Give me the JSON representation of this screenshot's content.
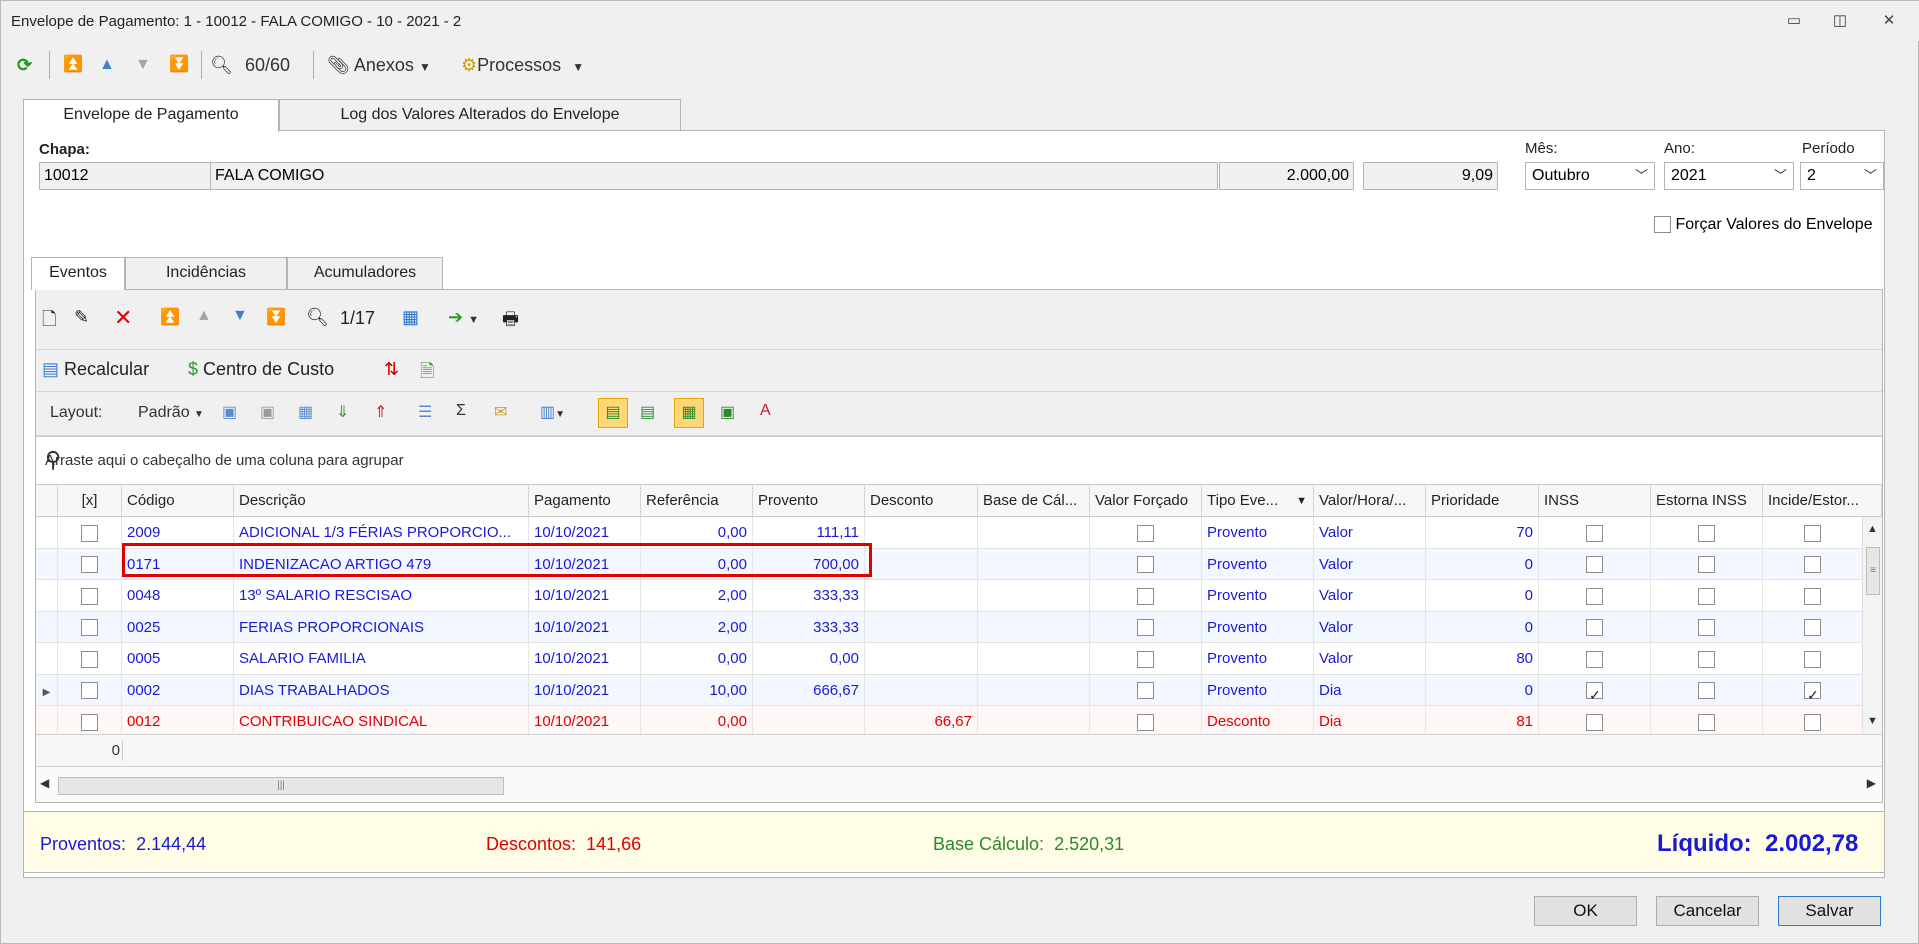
{
  "window": {
    "title": "Envelope de Pagamento: 1 - 10012 - FALA COMIGO - 10 - 2021 - 2"
  },
  "toolbar": {
    "counter": "60/60",
    "anexos": "Anexos",
    "processos": "Processos"
  },
  "tabs_top": [
    "Envelope de Pagamento",
    "Log dos Valores Alterados do Envelope"
  ],
  "header": {
    "chapa_label": "Chapa:",
    "chapa": "10012",
    "nome": "FALA COMIGO",
    "valor1": "2.000,00",
    "valor2": "9,09",
    "mes_label": "Mês:",
    "mes": "Outubro",
    "ano_label": "Ano:",
    "ano": "2021",
    "periodo_label": "Período",
    "periodo": "2",
    "forcar_label": "Forçar Valores do Envelope"
  },
  "tabs_inner": [
    "Eventos",
    "Incidências",
    "Acumuladores"
  ],
  "inner_toolbar": {
    "counter": "1/17",
    "recalcular": "Recalcular",
    "centro": "Centro de Custo",
    "layout_label": "Layout:",
    "layout_value": "Padrão"
  },
  "group_hint": "Arraste aqui o cabeçalho de uma coluna para agrupar",
  "columns": [
    "[x]",
    "Código",
    "Descrição",
    "Pagamento",
    "Referência",
    "Provento",
    "Desconto",
    "Base de Cál...",
    "Valor Forçado",
    "Tipo Eve...",
    "Valor/Hora/...",
    "Prioridade",
    "INSS",
    "Estorna INSS",
    "Incide/Estor..."
  ],
  "rows": [
    {
      "codigo": "2009",
      "descricao": "ADICIONAL 1/3 FÉRIAS PROPORCIO...",
      "pagamento": "10/10/2021",
      "referencia": "0,00",
      "provento": "111,11",
      "desconto": "",
      "tipo": "Provento",
      "vh": "Valor",
      "prioridade": "70",
      "inss": false,
      "incide": false
    },
    {
      "codigo": "0171",
      "descricao": "INDENIZACAO ARTIGO 479",
      "pagamento": "10/10/2021",
      "referencia": "0,00",
      "provento": "700,00",
      "desconto": "",
      "tipo": "Provento",
      "vh": "Valor",
      "prioridade": "0",
      "inss": false,
      "incide": false
    },
    {
      "codigo": "0048",
      "descricao": "13º SALARIO RESCISAO",
      "pagamento": "10/10/2021",
      "referencia": "2,00",
      "provento": "333,33",
      "desconto": "",
      "tipo": "Provento",
      "vh": "Valor",
      "prioridade": "0",
      "inss": false,
      "incide": false
    },
    {
      "codigo": "0025",
      "descricao": "FERIAS PROPORCIONAIS",
      "pagamento": "10/10/2021",
      "referencia": "2,00",
      "provento": "333,33",
      "desconto": "",
      "tipo": "Provento",
      "vh": "Valor",
      "prioridade": "0",
      "inss": false,
      "incide": false
    },
    {
      "codigo": "0005",
      "descricao": "SALARIO FAMILIA",
      "pagamento": "10/10/2021",
      "referencia": "0,00",
      "provento": "0,00",
      "desconto": "",
      "tipo": "Provento",
      "vh": "Valor",
      "prioridade": "80",
      "inss": false,
      "incide": false
    },
    {
      "codigo": "0002",
      "descricao": "DIAS TRABALHADOS",
      "pagamento": "10/10/2021",
      "referencia": "10,00",
      "provento": "666,67",
      "desconto": "",
      "tipo": "Provento",
      "vh": "Dia",
      "prioridade": "0",
      "inss": true,
      "incide": true
    },
    {
      "codigo": "0012",
      "descricao": "CONTRIBUICAO SINDICAL",
      "pagamento": "10/10/2021",
      "referencia": "0,00",
      "provento": "",
      "desconto": "66,67",
      "tipo": "Desconto",
      "vh": "Dia",
      "prioridade": "81",
      "inss": false,
      "incide": false
    }
  ],
  "footer_count": "0",
  "totals": {
    "proventos_label": "Proventos:",
    "proventos": "2.144,44",
    "descontos_label": "Descontos:",
    "descontos": "141,66",
    "base_label": "Base Cálculo:",
    "base": "2.520,31",
    "liquido_label": "Líquido:",
    "liquido": "2.002,78"
  },
  "buttons": {
    "ok": "OK",
    "cancelar": "Cancelar",
    "salvar": "Salvar"
  }
}
